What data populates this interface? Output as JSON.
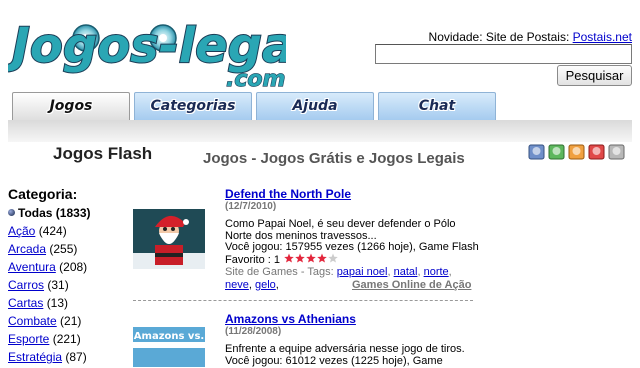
{
  "logo": {
    "text": "Jogos-legais",
    "suffix": ".com"
  },
  "header": {
    "novidade_label": "Novidade: Site de Postais:",
    "novidade_link": "Postais.net",
    "search_value": "",
    "search_button": "Pesquisar"
  },
  "tabs": [
    {
      "label": "Jogos",
      "active": true
    },
    {
      "label": "Categorias",
      "active": false
    },
    {
      "label": "Ajuda",
      "active": false
    },
    {
      "label": "Chat",
      "active": false
    }
  ],
  "page": {
    "heading": "Jogos Flash",
    "subtitle": "Jogos - Jogos Grátis e Jogos Legais"
  },
  "sidebar": {
    "title": "Categoria:",
    "items": [
      {
        "label": "Todas",
        "count": "(1833)",
        "selected": true
      },
      {
        "label": "Ação",
        "count": "(424)"
      },
      {
        "label": "Arcada",
        "count": "(255)"
      },
      {
        "label": "Aventura",
        "count": "(208)"
      },
      {
        "label": "Carros",
        "count": "(31)"
      },
      {
        "label": "Cartas",
        "count": "(13)"
      },
      {
        "label": "Combate",
        "count": "(21)"
      },
      {
        "label": "Esporte",
        "count": "(221)"
      },
      {
        "label": "Estratégia",
        "count": "(87)"
      }
    ]
  },
  "games": [
    {
      "title": "Defend the North Pole",
      "date": "(12/7/2010)",
      "description": "Como Papai Noel, é seu dever defender o Pólo Norte dos meninos travessos...",
      "played": "Você jogou: 157955 vezes (1266 hoje), Game Flash Favorito : 1",
      "rating": 4,
      "rating_max": 5,
      "tags_prefix": "Site de Games - Tags:",
      "tags": [
        "papai noel",
        "natal",
        "norte",
        "neve",
        "gelo"
      ],
      "online_link": "Games Online de Ação"
    },
    {
      "title": "Amazons vs Athenians",
      "date": "(11/28/2008)",
      "description": "Enfrente a equipe adversária nesse jogo de tiros.",
      "played": "Você jogou: 61012 vezes (1225 hoje), Game",
      "thumb_text": "Amazons vs."
    }
  ],
  "colors": {
    "link": "#0000cc",
    "tab_gradient_top": "#d8ebfb",
    "tab_gradient_bottom": "#a5cbef",
    "logo_teal": "#2aa6b4",
    "star": "#e3263c"
  }
}
